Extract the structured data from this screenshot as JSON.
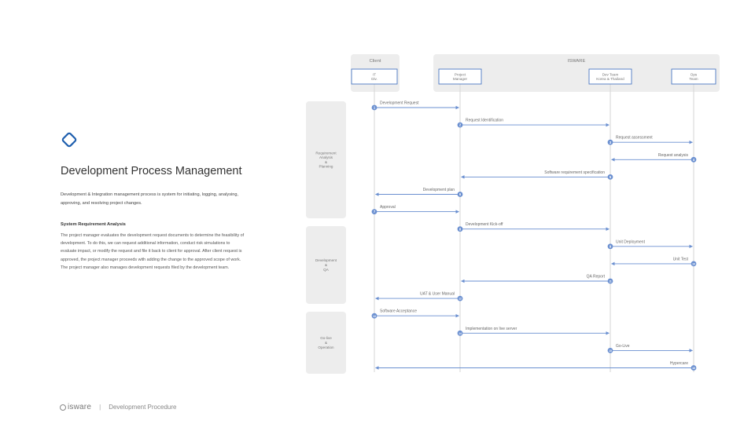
{
  "title": "Development Process Management",
  "intro": "Development & Integration management process is system for initiating, logging, analysing, approving, and resolving project changes.",
  "section": {
    "title": "System Requirement Analysis",
    "body": "The project manager evaluates the development request documents to determine the feasibility of development. To do this, we can request additional information, conduct risk simulations to evaluate impact, or modify the request and file it back to client for approval. After client request is approved, the project manager proceeds with adding the change to the approved scope of work. The project manager also manages development requests filed by the development team."
  },
  "footer": {
    "brand": "isware",
    "separator": "|",
    "page": "Development Procedure"
  },
  "colors": {
    "accent": "#1f5fae",
    "arrow": "#6a8fd0",
    "box_border": "#4a78c2",
    "panel": "#ededed"
  },
  "groups": [
    {
      "label": "Client",
      "from": 0,
      "to": 0
    },
    {
      "label": "ISWARE",
      "from": 1,
      "to": 3
    }
  ],
  "lanes": [
    {
      "label": "IT Div."
    },
    {
      "label": "Project Manager"
    },
    {
      "label": "Dev Team Korea & Thailand"
    },
    {
      "label": "Ops Team"
    }
  ],
  "phases": [
    {
      "label": "Requirement Analysis & Planning"
    },
    {
      "label": "Development & QA"
    },
    {
      "label": "Go-live & Operation"
    }
  ],
  "messages": [
    {
      "n": "1",
      "from": 0,
      "to": 1,
      "label": "Development Request"
    },
    {
      "n": "2",
      "from": 1,
      "to": 2,
      "label": "Request Identification"
    },
    {
      "n": "3",
      "from": 2,
      "to": 3,
      "label": "Request assessment"
    },
    {
      "n": "4",
      "from": 3,
      "to": 2,
      "label": "Request analysis"
    },
    {
      "n": "5",
      "from": 2,
      "to": 1,
      "label": "Software requirement specification"
    },
    {
      "n": "6",
      "from": 1,
      "to": 0,
      "label": "Development plan"
    },
    {
      "n": "7",
      "from": 0,
      "to": 1,
      "label": "Approval"
    },
    {
      "n": "8",
      "from": 1,
      "to": 2,
      "label": "Development Kick-off"
    },
    {
      "n": "9",
      "from": 2,
      "to": 3,
      "label": "Unit Deployment"
    },
    {
      "n": "10",
      "from": 3,
      "to": 2,
      "label": "Unit Test"
    },
    {
      "n": "11",
      "from": 2,
      "to": 1,
      "label": "QA Report"
    },
    {
      "n": "12",
      "from": 1,
      "to": 0,
      "label": "UAT & User Manual"
    },
    {
      "n": "13",
      "from": 0,
      "to": 1,
      "label": "Software Acceptance"
    },
    {
      "n": "14",
      "from": 1,
      "to": 2,
      "label": "Implementation on live server"
    },
    {
      "n": "15",
      "from": 2,
      "to": 3,
      "label": "Go-Live"
    },
    {
      "n": "16",
      "from": 3,
      "to": 0,
      "label": "Hypercare"
    }
  ]
}
